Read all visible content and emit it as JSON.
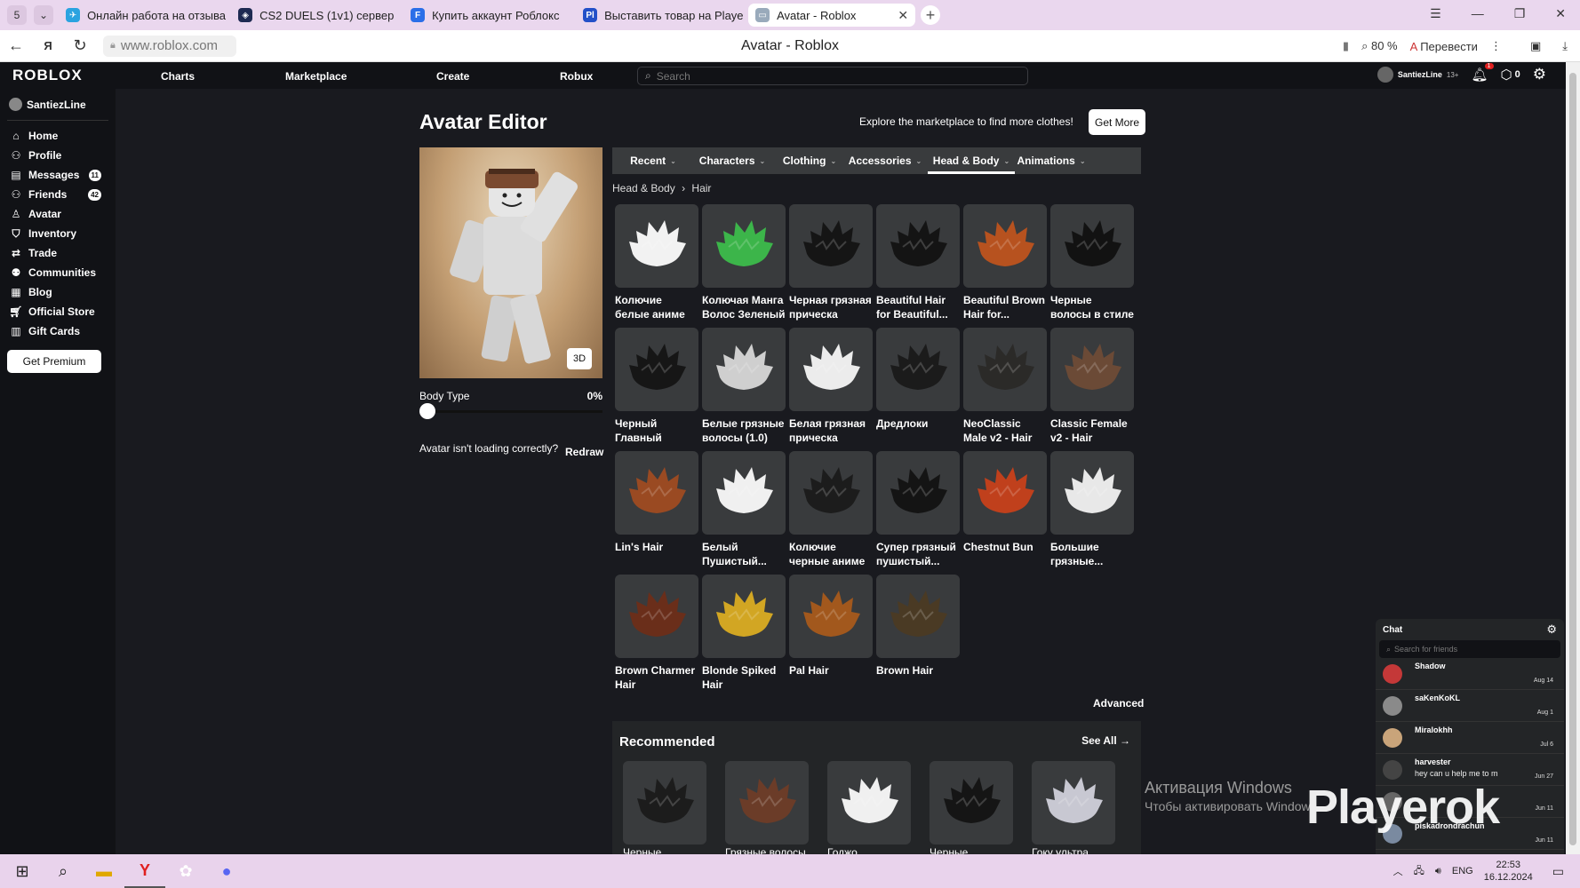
{
  "browser": {
    "tab_count": "5",
    "tabs": [
      {
        "title": "Онлайн работа на отзыва",
        "active": false
      },
      {
        "title": "CS2 DUELS (1v1) сервер",
        "active": false
      },
      {
        "title": "Купить аккаунт Роблокс",
        "active": false
      },
      {
        "title": "Выставить товар на Playe",
        "active": false
      },
      {
        "title": "Avatar - Roblox",
        "active": true
      }
    ],
    "url": "www.roblox.com",
    "page_title": "Avatar - Roblox",
    "zoom": "80 %",
    "translate": "Перевести"
  },
  "nav": {
    "logo": "ROBLOX",
    "links": [
      "Charts",
      "Marketplace",
      "Create",
      "Robux"
    ],
    "search_placeholder": "Search",
    "username": "SantiezLine",
    "age_tag": "13+",
    "notifications": "1",
    "robux": "0"
  },
  "sidebar": {
    "username": "SantiezLine",
    "items": [
      {
        "label": "Home",
        "icon": "home-icon",
        "badge": ""
      },
      {
        "label": "Profile",
        "icon": "profile-icon",
        "badge": ""
      },
      {
        "label": "Messages",
        "icon": "messages-icon",
        "badge": "11"
      },
      {
        "label": "Friends",
        "icon": "friends-icon",
        "badge": "42"
      },
      {
        "label": "Avatar",
        "icon": "avatar-icon",
        "badge": ""
      },
      {
        "label": "Inventory",
        "icon": "inventory-icon",
        "badge": ""
      },
      {
        "label": "Trade",
        "icon": "trade-icon",
        "badge": ""
      },
      {
        "label": "Communities",
        "icon": "communities-icon",
        "badge": ""
      },
      {
        "label": "Blog",
        "icon": "blog-icon",
        "badge": ""
      },
      {
        "label": "Official Store",
        "icon": "store-icon",
        "badge": ""
      },
      {
        "label": "Gift Cards",
        "icon": "gift-card-icon",
        "badge": ""
      }
    ],
    "premium_button": "Get Premium"
  },
  "editor": {
    "title": "Avatar Editor",
    "explore_text": "Explore the marketplace to find more clothes!",
    "get_more": "Get More",
    "btn_3d": "3D",
    "body_type_label": "Body Type",
    "body_type_value": "0%",
    "body_type_level": 0,
    "loading_question": "Avatar isn't loading correctly?",
    "redraw": "Redraw",
    "tabs": [
      "Recent",
      "Characters",
      "Clothing",
      "Accessories",
      "Head & Body",
      "Animations"
    ],
    "selected_tab": "Head & Body",
    "breadcrumb_root": "Head & Body",
    "breadcrumb_leaf": "Hair",
    "items": [
      {
        "name": "Колючие белые аниме волосы",
        "color": "#f2f2f2"
      },
      {
        "name": "Колючая Манга Волос Зеленый",
        "color": "#3cb54a"
      },
      {
        "name": "Черная грязная прическа",
        "color": "#151515"
      },
      {
        "name": "Beautiful Hair for Beautiful...",
        "color": "#141414"
      },
      {
        "name": "Beautiful Brown Hair for...",
        "color": "#b7521f"
      },
      {
        "name": "Черные волосы в стиле аниме",
        "color": "#121212"
      },
      {
        "name": "Черный Главный Персонаж...",
        "color": "#161616"
      },
      {
        "name": "Белые грязные волосы (1.0)",
        "color": "#cfcfcf"
      },
      {
        "name": "Белая грязная прическа",
        "color": "#ececec"
      },
      {
        "name": "Дредлоки",
        "color": "#1b1b1b"
      },
      {
        "name": "NeoClassic Male v2 - Hair",
        "color": "#2b2a28"
      },
      {
        "name": "Classic Female v2 - Hair",
        "color": "#6b4a36"
      },
      {
        "name": "Lin's Hair",
        "color": "#9a4a22"
      },
      {
        "name": "Белый Пушистый...",
        "color": "#f0f0f0"
      },
      {
        "name": "Колючие черные аниме волосы",
        "color": "#1c1c1c"
      },
      {
        "name": "Супер грязный пушистый...",
        "color": "#141414"
      },
      {
        "name": "Chestnut Bun",
        "color": "#c0401c"
      },
      {
        "name": "Большие грязные...",
        "color": "#e8e8e8"
      },
      {
        "name": "Brown Charmer Hair",
        "color": "#6a2e1a"
      },
      {
        "name": "Blonde Spiked Hair",
        "color": "#d2a623"
      },
      {
        "name": "Pal Hair",
        "color": "#a2581d"
      },
      {
        "name": "Brown Hair",
        "color": "#4a3a24"
      }
    ],
    "advanced": "Advanced"
  },
  "recommended": {
    "title": "Recommended",
    "see_all": "See All →",
    "items": [
      {
        "name": "Черные",
        "color": "#1c1c1c"
      },
      {
        "name": "Грязные волосы",
        "color": "#6b3c28"
      },
      {
        "name": "Годжо",
        "color": "#f0f0f0"
      },
      {
        "name": "Черные",
        "color": "#151515"
      },
      {
        "name": "Гоку ультра",
        "color": "#c8c8d2"
      }
    ]
  },
  "chat": {
    "title": "Chat",
    "search_placeholder": "Search for friends",
    "entries": [
      {
        "name": "Shadow",
        "message": "",
        "date": "Aug 14",
        "color": "#c43838"
      },
      {
        "name": "saKenKoKL",
        "message": "",
        "date": "Aug 1",
        "color": "#8a8a8a"
      },
      {
        "name": "Miralokhh",
        "message": "",
        "date": "Jul 6",
        "color": "#c9a47a"
      },
      {
        "name": "harvester",
        "message": "hey can u help me to m",
        "date": "Jun 27",
        "color": "#444444"
      },
      {
        "name": "",
        "message": "",
        "date": "Jun 11",
        "color": "#666666"
      },
      {
        "name": "piskadrondrachun",
        "message": "",
        "date": "Jun 11",
        "color": "#7a8aa0"
      }
    ]
  },
  "watermark": {
    "windows_line1": "Активация Windows",
    "windows_line2": "Чтобы активировать Window",
    "brand": "Playerok"
  },
  "taskbar": {
    "lang": "ENG",
    "time": "22:53",
    "date": "16.12.2024"
  }
}
